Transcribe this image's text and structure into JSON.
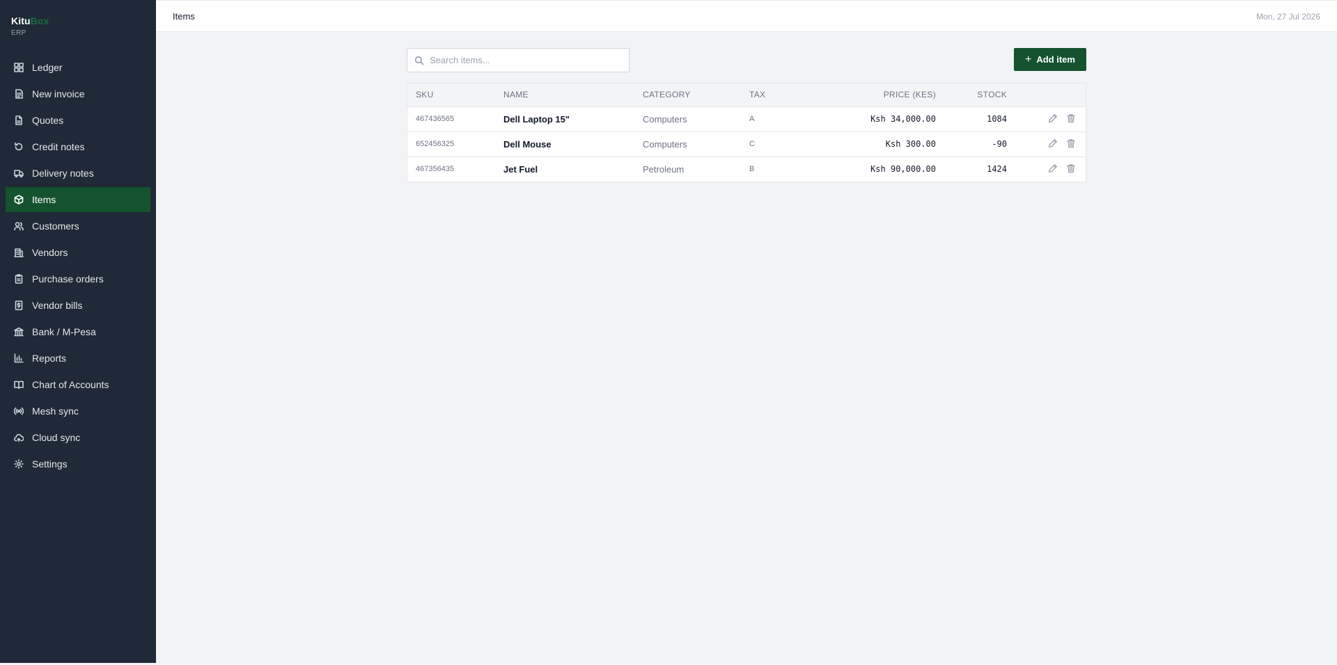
{
  "brand": {
    "name_part1": "Kitu",
    "name_part2": "Box",
    "subtitle": "ERP"
  },
  "sidebar": {
    "items": [
      {
        "label": "Ledger",
        "icon": "grid-icon",
        "active": false
      },
      {
        "label": "New invoice",
        "icon": "document-icon",
        "active": false
      },
      {
        "label": "Quotes",
        "icon": "file-icon",
        "active": false
      },
      {
        "label": "Credit notes",
        "icon": "rotate-icon",
        "active": false
      },
      {
        "label": "Delivery notes",
        "icon": "truck-icon",
        "active": false
      },
      {
        "label": "Items",
        "icon": "box-icon",
        "active": true
      },
      {
        "label": "Customers",
        "icon": "users-icon",
        "active": false
      },
      {
        "label": "Vendors",
        "icon": "building-icon",
        "active": false
      },
      {
        "label": "Purchase orders",
        "icon": "clipboard-icon",
        "active": false
      },
      {
        "label": "Vendor bills",
        "icon": "dollar-file-icon",
        "active": false
      },
      {
        "label": "Bank / M-Pesa",
        "icon": "bank-icon",
        "active": false
      },
      {
        "label": "Reports",
        "icon": "bar-chart-icon",
        "active": false
      },
      {
        "label": "Chart of Accounts",
        "icon": "book-icon",
        "active": false
      },
      {
        "label": "Mesh sync",
        "icon": "broadcast-icon",
        "active": false
      },
      {
        "label": "Cloud sync",
        "icon": "cloud-icon",
        "active": false
      },
      {
        "label": "Settings",
        "icon": "gear-icon",
        "active": false
      }
    ]
  },
  "header": {
    "title": "Items",
    "date": "Mon, 27 Jul 2026"
  },
  "toolbar": {
    "search_placeholder": "Search items...",
    "search_value": "",
    "add_label": "Add item",
    "add_icon": "plus-icon"
  },
  "table": {
    "columns": {
      "sku": "SKU",
      "name": "NAME",
      "category": "CATEGORY",
      "tax": "TAX",
      "price": "PRICE (KES)",
      "stock": "STOCK"
    },
    "rows": [
      {
        "sku": "467436565",
        "name": "Dell Laptop 15\"",
        "category": "Computers",
        "tax": "A",
        "price": "Ksh 34,000.00",
        "stock": "1084"
      },
      {
        "sku": "652456325",
        "name": "Dell Mouse",
        "category": "Computers",
        "tax": "C",
        "price": "Ksh 300.00",
        "stock": "-90"
      },
      {
        "sku": "467356435",
        "name": "Jet Fuel",
        "category": "Petroleum",
        "tax": "B",
        "price": "Ksh 90,000.00",
        "stock": "1424"
      }
    ]
  },
  "colors": {
    "sidebar_bg": "#1f2937",
    "accent": "#14532d",
    "page_bg": "#f2f3f5"
  }
}
